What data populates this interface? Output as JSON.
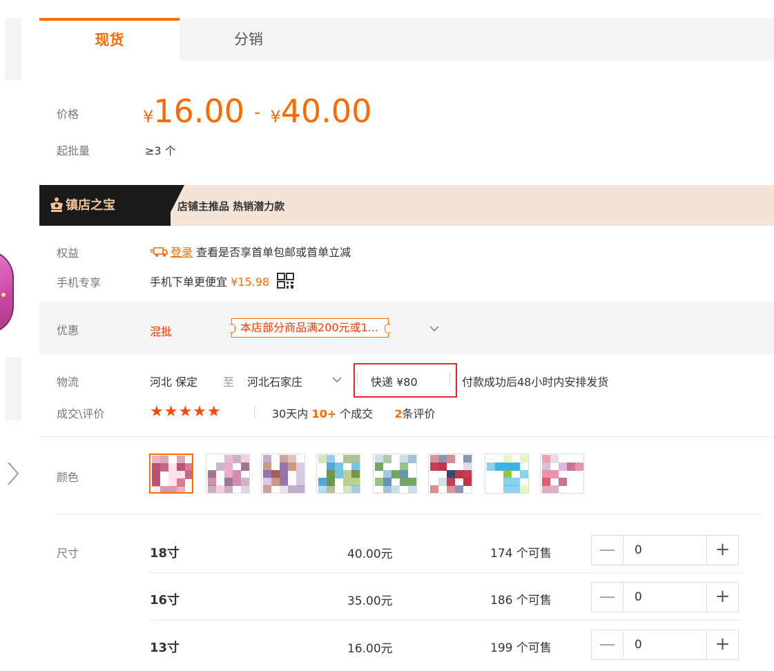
{
  "tabs": [
    {
      "label": "现货",
      "active": true
    },
    {
      "label": "分销",
      "active": false
    }
  ],
  "price": {
    "label": "价格",
    "min_yen": "¥",
    "min": "16.00",
    "dash": "-",
    "max_yen": "¥",
    "max": "40.00"
  },
  "moq": {
    "label": "起批量",
    "value": "≥3 个"
  },
  "banner": {
    "title": "镇店之宝",
    "desc": "店铺主推品  热销潜力款"
  },
  "benefits": {
    "label": "权益",
    "login": "登录",
    "text": "查看是否享首单包邮或首单立减"
  },
  "mobile": {
    "label": "手机专享",
    "text": "手机下单更便宜",
    "price": "¥15.98"
  },
  "promo": {
    "label": "优惠",
    "mixed": "混批",
    "coupon": "本店部分商品满200元或1..."
  },
  "logistics": {
    "label": "物流",
    "from": "河北 保定",
    "to_word": "至",
    "to": "河北石家庄",
    "express": "快递 ¥80",
    "note": "付款成功后48小时内安排发货"
  },
  "deals": {
    "label": "成交\\评价",
    "stars": "★★★★★",
    "prefix": "30天内",
    "count": "10+",
    "unit": "个成交",
    "reviews": "2",
    "reviews_unit": "条评价"
  },
  "color": {
    "label": "颜色"
  },
  "size": {
    "label": "尺寸",
    "rows": [
      {
        "name": "18寸",
        "price": "40.00元",
        "stock": "174 个可售",
        "qty": "0"
      },
      {
        "name": "16寸",
        "price": "35.00元",
        "stock": "186 个可售",
        "qty": "0"
      },
      {
        "name": "13寸",
        "price": "16.00元",
        "stock": "199 个可售",
        "qty": "0"
      }
    ]
  },
  "colors": {
    "accent": "#ff6a00",
    "highlight_box": "#e8232a",
    "banner_bg": "#f4e4d7"
  },
  "stepper": {
    "minus": "—",
    "plus": "+"
  }
}
